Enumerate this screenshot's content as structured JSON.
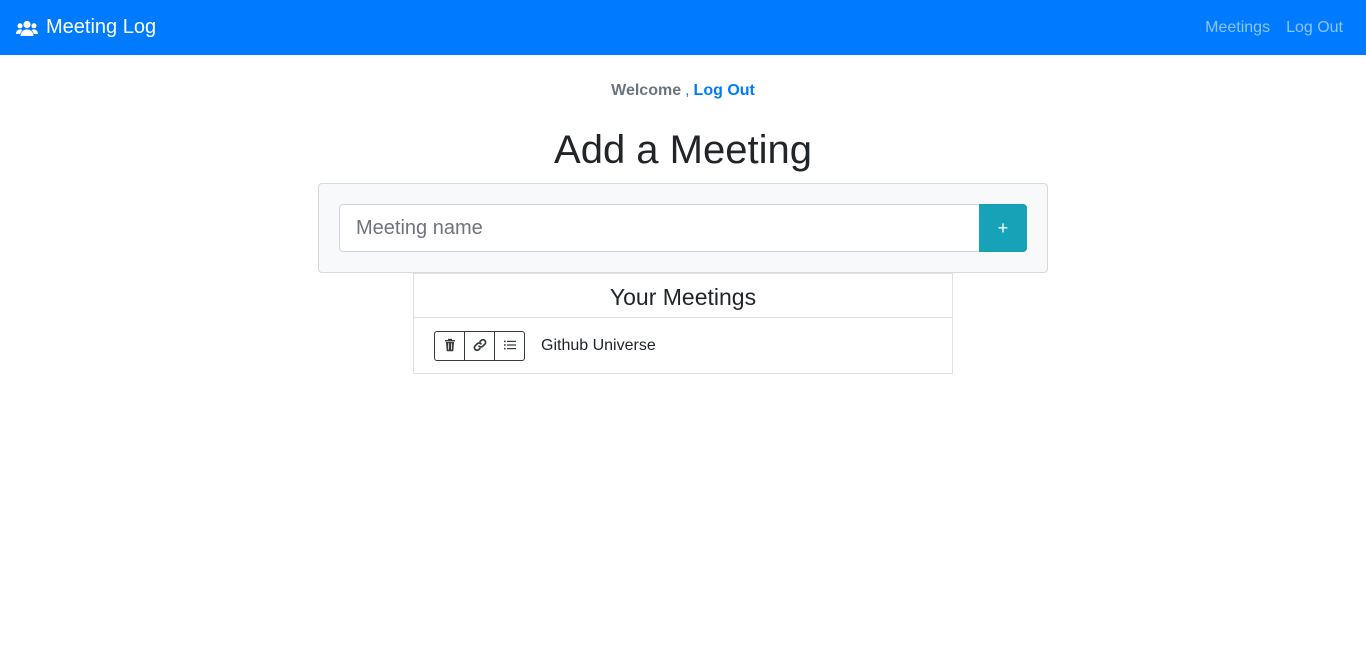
{
  "navbar": {
    "brand_icon": "users-icon",
    "brand_text": "Meeting Log",
    "links": [
      "Meetings",
      "Log Out"
    ],
    "bg_color": "#007bff"
  },
  "welcome": {
    "text": "Welcome",
    "separator": ",",
    "logout_link": "Log Out"
  },
  "page": {
    "title": "Add a Meeting"
  },
  "add_form": {
    "input_value": "",
    "input_placeholder": "Meeting name",
    "add_button_label": "+",
    "add_button_color": "#17a2b8"
  },
  "meetings": {
    "header": "Your Meetings",
    "items": [
      {
        "name": "Github Universe",
        "actions": [
          "trash-icon",
          "link-icon",
          "list-icon"
        ]
      }
    ]
  }
}
